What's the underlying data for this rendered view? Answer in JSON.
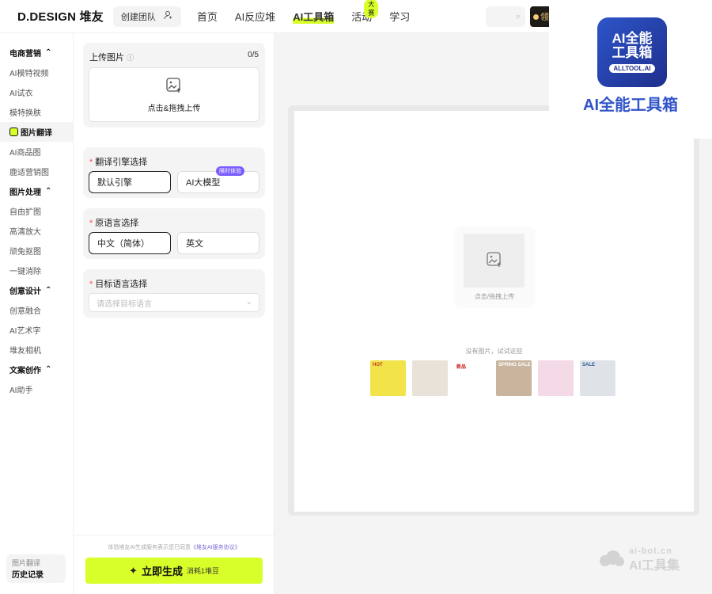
{
  "header": {
    "logo": "D.DESIGN 堆友",
    "team_button": "创建团队",
    "nav": [
      {
        "label": "首页"
      },
      {
        "label": "AI反应堆"
      },
      {
        "label": "AI工具箱"
      },
      {
        "label": "活动",
        "badge": "大赛"
      },
      {
        "label": "学习"
      }
    ],
    "coupon_text": "领"
  },
  "sidebar": {
    "groups": [
      {
        "title": "电商营销",
        "items": [
          "AI模特视频",
          "AI试衣",
          "模特换肤",
          "图片翻译",
          "AI商品图",
          "鹿适营销图"
        ]
      },
      {
        "title": "图片处理",
        "items": [
          "自由扩图",
          "高清放大",
          "顽兔抠图",
          "一键消除"
        ]
      },
      {
        "title": "创意设计",
        "items": [
          "创意融合",
          "AI艺术字",
          "堆友相机"
        ]
      },
      {
        "title": "文案创作",
        "items": [
          "AI助手"
        ]
      }
    ],
    "active_item": "图片翻译",
    "history": {
      "sub": "图片翻译",
      "main": "历史记录"
    }
  },
  "form": {
    "upload": {
      "title": "上传图片",
      "counter": "0/5",
      "label": "点击&拖拽上传"
    },
    "engine": {
      "title": "翻译引擎选择",
      "options": [
        "默认引擎",
        "AI大模型"
      ],
      "tag": "限时体验"
    },
    "source_lang": {
      "title": "原语言选择",
      "options": [
        "中文（简体）",
        "英文"
      ]
    },
    "target_lang": {
      "title": "目标语言选择",
      "placeholder": "请选择目标语言"
    },
    "agreement": "体验堆友AI生成服务表示您已同意",
    "agreement_link": "《堆友AI服务协议》",
    "generate": {
      "label": "立即生成",
      "cost": "消耗1堆豆"
    }
  },
  "canvas": {
    "upload_label": "点击/拖拽上传",
    "try_text": "没有图片，试试这些",
    "samples": [
      {
        "text": "HOT",
        "bg": "#f2e34a",
        "fg": "#c53b1e"
      },
      {
        "text": "",
        "bg": "#e9e2d8",
        "fg": "#222"
      },
      {
        "text": "新品",
        "bg": "#ffffff",
        "fg": "#c8201f"
      },
      {
        "text": "SPRING SALE",
        "bg": "#c9b49d",
        "fg": "#fff"
      },
      {
        "text": "",
        "bg": "#f4d9e6",
        "fg": "#333"
      },
      {
        "text": "SALE",
        "bg": "#dfe3e8",
        "fg": "#2d5a9a"
      }
    ]
  },
  "promo": {
    "badge_line1": "AI全能",
    "badge_line2": "工具箱",
    "badge_url": "ALLTOOL.AI",
    "name": "AI全能工具箱"
  },
  "watermark": {
    "line1": "ai-bot.cn",
    "line2": "AI工具集"
  }
}
